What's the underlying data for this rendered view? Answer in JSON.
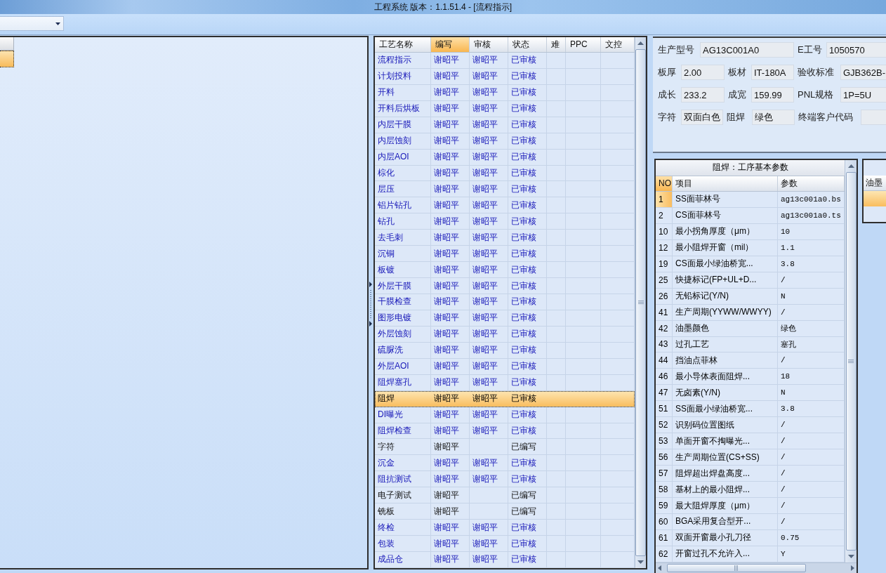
{
  "window": {
    "title": "工程系统   版本：1.1.51.4 - [流程指示]"
  },
  "left_table": {
    "rows": [
      {
        "selected": true
      }
    ]
  },
  "process_table": {
    "columns": [
      {
        "label": "工艺名称",
        "selected": false
      },
      {
        "label": "编写",
        "selected": true
      },
      {
        "label": "审核",
        "selected": false
      },
      {
        "label": "状态",
        "selected": false
      },
      {
        "label": "难",
        "selected": false
      },
      {
        "label": "PPC",
        "selected": false
      },
      {
        "label": "文控",
        "selected": false
      }
    ],
    "rows": [
      {
        "name": "流程指示",
        "author": "谢昭平",
        "reviewer": "谢昭平",
        "status": "已审核",
        "approved": true,
        "selected": false
      },
      {
        "name": "计划投料",
        "author": "谢昭平",
        "reviewer": "谢昭平",
        "status": "已审核",
        "approved": true,
        "selected": false
      },
      {
        "name": "开料",
        "author": "谢昭平",
        "reviewer": "谢昭平",
        "status": "已审核",
        "approved": true,
        "selected": false
      },
      {
        "name": "开料后烘板",
        "author": "谢昭平",
        "reviewer": "谢昭平",
        "status": "已审核",
        "approved": true,
        "selected": false
      },
      {
        "name": "内层干膜",
        "author": "谢昭平",
        "reviewer": "谢昭平",
        "status": "已审核",
        "approved": true,
        "selected": false
      },
      {
        "name": "内层蚀刻",
        "author": "谢昭平",
        "reviewer": "谢昭平",
        "status": "已审核",
        "approved": true,
        "selected": false
      },
      {
        "name": "内层AOI",
        "author": "谢昭平",
        "reviewer": "谢昭平",
        "status": "已审核",
        "approved": true,
        "selected": false
      },
      {
        "name": "棕化",
        "author": "谢昭平",
        "reviewer": "谢昭平",
        "status": "已审核",
        "approved": true,
        "selected": false
      },
      {
        "name": "层压",
        "author": "谢昭平",
        "reviewer": "谢昭平",
        "status": "已审核",
        "approved": true,
        "selected": false
      },
      {
        "name": "铝片钻孔",
        "author": "谢昭平",
        "reviewer": "谢昭平",
        "status": "已审核",
        "approved": true,
        "selected": false
      },
      {
        "name": "钻孔",
        "author": "谢昭平",
        "reviewer": "谢昭平",
        "status": "已审核",
        "approved": true,
        "selected": false
      },
      {
        "name": "去毛刺",
        "author": "谢昭平",
        "reviewer": "谢昭平",
        "status": "已审核",
        "approved": true,
        "selected": false
      },
      {
        "name": "沉铜",
        "author": "谢昭平",
        "reviewer": "谢昭平",
        "status": "已审核",
        "approved": true,
        "selected": false
      },
      {
        "name": "板镀",
        "author": "谢昭平",
        "reviewer": "谢昭平",
        "status": "已审核",
        "approved": true,
        "selected": false
      },
      {
        "name": "外层干膜",
        "author": "谢昭平",
        "reviewer": "谢昭平",
        "status": "已审核",
        "approved": true,
        "selected": false
      },
      {
        "name": "干膜检查",
        "author": "谢昭平",
        "reviewer": "谢昭平",
        "status": "已审核",
        "approved": true,
        "selected": false
      },
      {
        "name": "图形电镀",
        "author": "谢昭平",
        "reviewer": "谢昭平",
        "status": "已审核",
        "approved": true,
        "selected": false
      },
      {
        "name": "外层蚀刻",
        "author": "谢昭平",
        "reviewer": "谢昭平",
        "status": "已审核",
        "approved": true,
        "selected": false
      },
      {
        "name": "硫脲洗",
        "author": "谢昭平",
        "reviewer": "谢昭平",
        "status": "已审核",
        "approved": true,
        "selected": false
      },
      {
        "name": "外层AOI",
        "author": "谢昭平",
        "reviewer": "谢昭平",
        "status": "已审核",
        "approved": true,
        "selected": false
      },
      {
        "name": "阻焊塞孔",
        "author": "谢昭平",
        "reviewer": "谢昭平",
        "status": "已审核",
        "approved": true,
        "selected": false
      },
      {
        "name": "阻焊",
        "author": "谢昭平",
        "reviewer": "谢昭平",
        "status": "已审核",
        "approved": true,
        "selected": true
      },
      {
        "name": "DI曝光",
        "author": "谢昭平",
        "reviewer": "谢昭平",
        "status": "已审核",
        "approved": true,
        "selected": false
      },
      {
        "name": "阻焊检查",
        "author": "谢昭平",
        "reviewer": "谢昭平",
        "status": "已审核",
        "approved": true,
        "selected": false
      },
      {
        "name": "字符",
        "author": "谢昭平",
        "status": "已编写",
        "approved": false,
        "selected": false
      },
      {
        "name": "沉金",
        "author": "谢昭平",
        "reviewer": "谢昭平",
        "status": "已审核",
        "approved": true,
        "selected": false
      },
      {
        "name": "阻抗测试",
        "author": "谢昭平",
        "reviewer": "谢昭平",
        "status": "已审核",
        "approved": true,
        "selected": false
      },
      {
        "name": "电子测试",
        "author": "谢昭平",
        "status": "已编写",
        "approved": false,
        "selected": false
      },
      {
        "name": "铣板",
        "author": "谢昭平",
        "status": "已编写",
        "approved": false,
        "selected": false
      },
      {
        "name": "终检",
        "author": "谢昭平",
        "reviewer": "谢昭平",
        "status": "已审核",
        "approved": true,
        "selected": false
      },
      {
        "name": "包装",
        "author": "谢昭平",
        "reviewer": "谢昭平",
        "status": "已审核",
        "approved": true,
        "selected": false
      },
      {
        "name": "成品仓",
        "author": "谢昭平",
        "reviewer": "谢昭平",
        "status": "已审核",
        "approved": true,
        "selected": false
      }
    ]
  },
  "info_form": {
    "fields": [
      {
        "label": "生产型号",
        "value": "AG13C001A0"
      },
      {
        "label": "E工号",
        "value": "1050570"
      },
      {
        "label": "板厚",
        "value": "2.00"
      },
      {
        "label": "板材",
        "value": "IT-180A"
      },
      {
        "label": "验收标准",
        "value": "GJB362B-"
      },
      {
        "label": "成长",
        "value": "233.2"
      },
      {
        "label": "成宽",
        "value": "159.99"
      },
      {
        "label": "PNL规格",
        "value": "1P=5U"
      },
      {
        "label": "字符",
        "value": "双面白色"
      },
      {
        "label": "阻焊",
        "value": "绿色"
      },
      {
        "label": "终端客户代码"
      }
    ]
  },
  "param_table": {
    "title": "阻焊：工序基本参数",
    "columns": [
      {
        "label": "NO",
        "selected": true
      },
      {
        "label": "项目",
        "selected": false
      },
      {
        "label": "参数",
        "selected": false
      }
    ],
    "rows": [
      {
        "no": "1",
        "item": "SS面菲林号",
        "value": "ag13c001a0.bs",
        "selected": true
      },
      {
        "no": "2",
        "item": "CS面菲林号",
        "value": "ag13c001a0.ts",
        "selected": false
      },
      {
        "no": "10",
        "item": "最小拐角厚度（μm）",
        "value": "10",
        "selected": false
      },
      {
        "no": "12",
        "item": "最小阻焊开窗（mil）",
        "value": "1.1",
        "selected": false
      },
      {
        "no": "19",
        "item": "CS面最小绿油桥宽...",
        "value": "3.8",
        "selected": false
      },
      {
        "no": "25",
        "item": "快捷标记(FP+UL+D...",
        "value": "/",
        "selected": false
      },
      {
        "no": "26",
        "item": "无铅标记(Y/N)",
        "value": "N",
        "selected": false
      },
      {
        "no": "41",
        "item": "生产周期(YYWW/WWYY)",
        "value": "/",
        "selected": false
      },
      {
        "no": "42",
        "item": "油墨颜色",
        "value": "绿色",
        "selected": false
      },
      {
        "no": "43",
        "item": "过孔工艺",
        "value": "塞孔",
        "selected": false
      },
      {
        "no": "44",
        "item": "挡油点菲林",
        "value": "/",
        "selected": false
      },
      {
        "no": "46",
        "item": "最小导体表面阻焊...",
        "value": "18",
        "selected": false
      },
      {
        "no": "47",
        "item": "无卤素(Y/N)",
        "value": "N",
        "selected": false
      },
      {
        "no": "51",
        "item": "SS面最小绿油桥宽...",
        "value": "3.8",
        "selected": false
      },
      {
        "no": "52",
        "item": "识别码位置图纸",
        "value": "/",
        "selected": false
      },
      {
        "no": "53",
        "item": "单面开窗不掏曝光...",
        "value": "/",
        "selected": false
      },
      {
        "no": "56",
        "item": "生产周期位置(CS+SS)",
        "value": "/",
        "selected": false
      },
      {
        "no": "57",
        "item": "阻焊超出焊盘高度...",
        "value": "/",
        "selected": false
      },
      {
        "no": "58",
        "item": "基材上的最小阻焊...",
        "value": "/",
        "selected": false
      },
      {
        "no": "59",
        "item": "最大阻焊厚度（μm）",
        "value": "/",
        "selected": false
      },
      {
        "no": "60",
        "item": "BGA采用复合型开...",
        "value": "/",
        "selected": false
      },
      {
        "no": "61",
        "item": "双面开窗最小孔刀径",
        "value": "0.75",
        "selected": false
      },
      {
        "no": "62",
        "item": "开窗过孔不允许入...",
        "value": "Y",
        "selected": false
      }
    ]
  },
  "side_table": {
    "columns": [
      {
        "label": "油墨"
      }
    ],
    "rows": [
      {
        "selected": true
      }
    ]
  }
}
